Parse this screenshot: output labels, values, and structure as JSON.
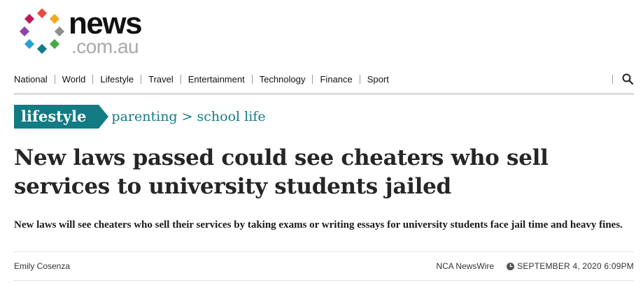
{
  "brand": {
    "name_main": "news",
    "name_domain": ".com.au",
    "dot_colors": [
      "#e84c3d",
      "#f5a623",
      "#8e8e8e",
      "#4aa843",
      "#2a9fd6",
      "#127b84",
      "#8e44ad",
      "#c2185b"
    ]
  },
  "nav": {
    "items": [
      {
        "label": "National"
      },
      {
        "label": "World"
      },
      {
        "label": "Lifestyle"
      },
      {
        "label": "Travel"
      },
      {
        "label": "Entertainment"
      },
      {
        "label": "Technology"
      },
      {
        "label": "Finance"
      },
      {
        "label": "Sport"
      }
    ],
    "search_icon": "search-icon"
  },
  "section": {
    "tag": "lifestyle",
    "crumbs": [
      "parenting",
      "school life"
    ],
    "crumb_separator": ">",
    "accent_color": "#127b84"
  },
  "article": {
    "headline": "New laws passed could see cheaters who sell services to university students jailed",
    "standfirst": "New laws will see cheaters who sell their services by taking exams or writing essays for university students face jail time and heavy fines.",
    "author": "Emily Cosenza",
    "source": "NCA NewsWire",
    "date": "SEPTEMBER 4, 2020 6:09PM",
    "date_icon": "clock-icon"
  }
}
